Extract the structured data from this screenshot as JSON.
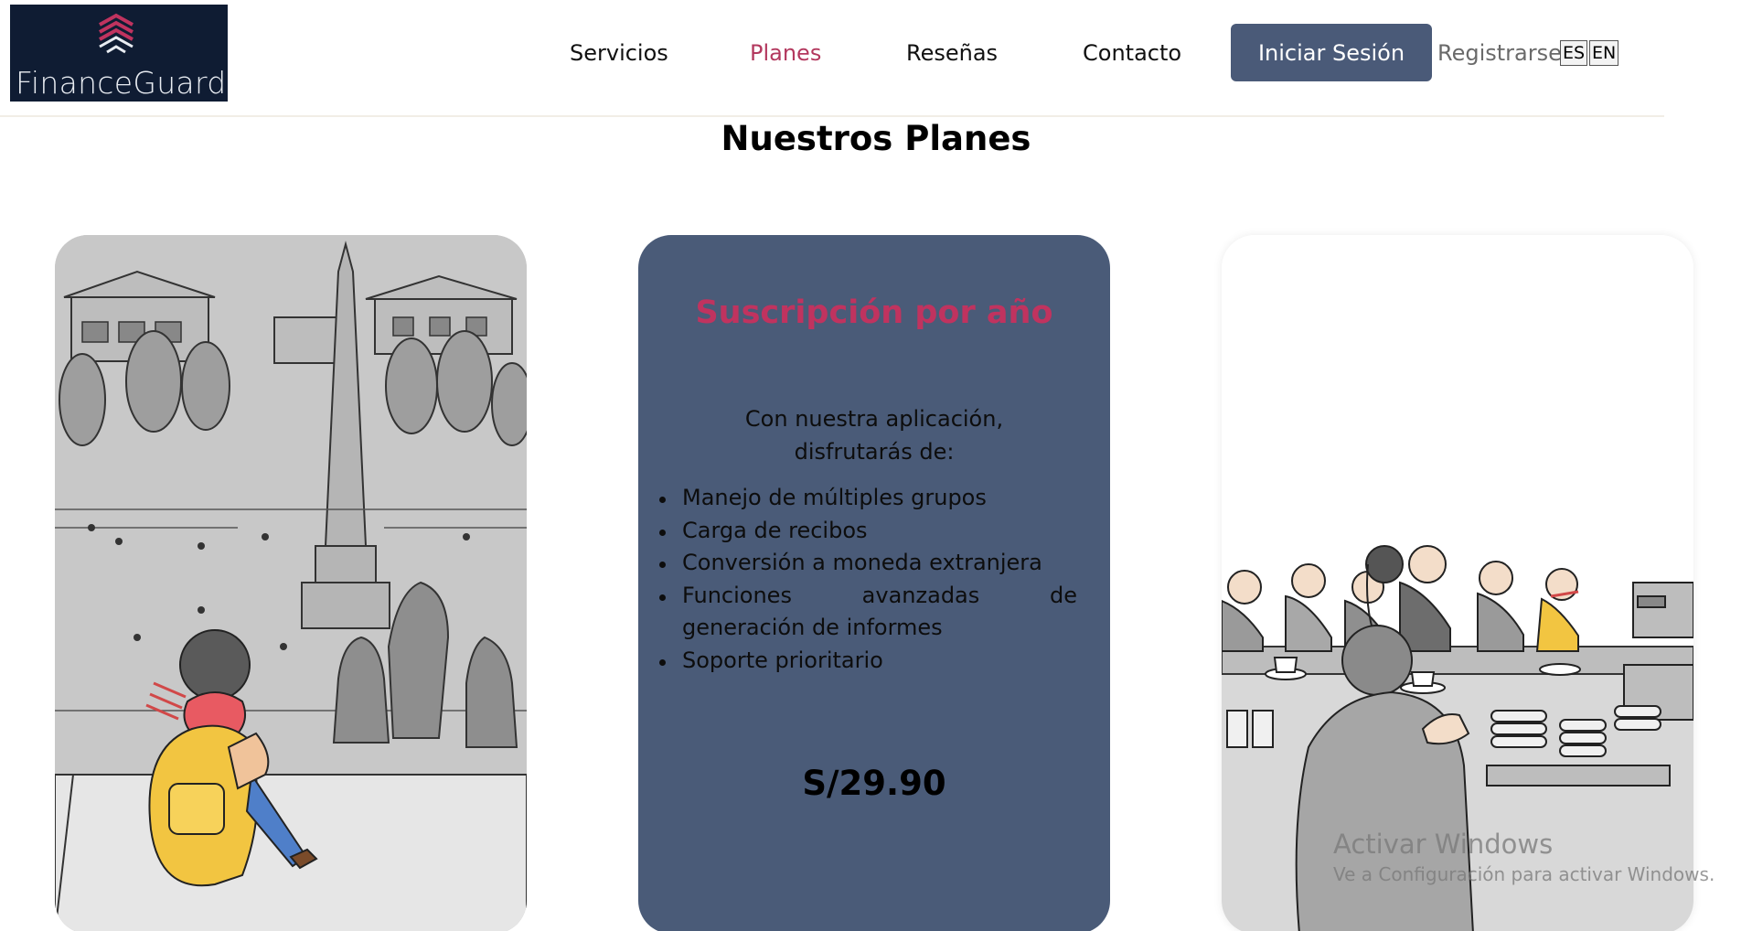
{
  "brand": {
    "name": "FinanceGuard",
    "logo_icon": "layered-diamond-icon",
    "logo_bg": "#0f1c33",
    "logo_accent": "#c0335f"
  },
  "nav": {
    "items": [
      {
        "label": "Servicios",
        "active": false
      },
      {
        "label": "Planes",
        "active": true
      },
      {
        "label": "Reseñas",
        "active": false
      },
      {
        "label": "Contacto",
        "active": false
      }
    ],
    "login_label": "Iniciar Sesión",
    "register_label": "Registrarse",
    "lang_es": "ES",
    "lang_en": "EN"
  },
  "section": {
    "title": "Nuestros Planes"
  },
  "plan": {
    "title": "Suscripción por año",
    "intro": "Con nuestra aplicación, disfrutarás de:",
    "features": [
      "Manejo de múltiples grupos",
      "Carga de recibos",
      "Conversión a moneda extranjera",
      "Funciones avanzadas de generación de informes",
      "Soporte prioritario"
    ],
    "price": "S/29.90"
  },
  "images": {
    "left": "city-square-sketch-illustration",
    "right": "cafe-sketch-illustration"
  },
  "watermark": {
    "title": "Activar Windows",
    "subtitle": "Ve a Configuración para activar Windows."
  },
  "colors": {
    "accent": "#b3385e",
    "button": "#4a5a78",
    "card": "#4a5b78",
    "plan_title": "#c0335f"
  }
}
